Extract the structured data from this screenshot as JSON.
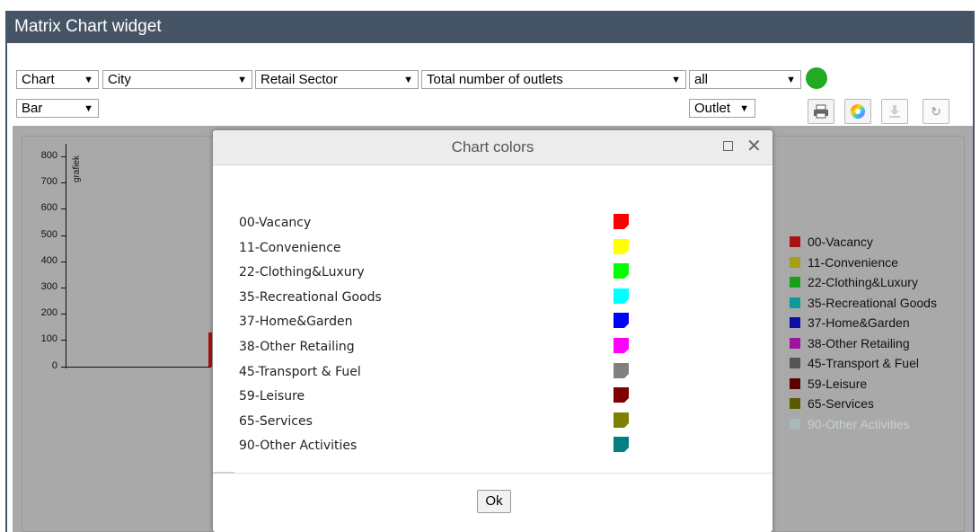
{
  "widget": {
    "title": "Matrix Chart widget"
  },
  "toolbar": {
    "chart_select": "Chart",
    "city_select": "City",
    "sector_select": "Retail Sector",
    "measure_select": "Total number of outlets",
    "filter_select": "all",
    "type_select": "Bar",
    "unit_select": "Outlet",
    "status_color": "#22aa22",
    "icons": [
      "print-icon",
      "color-wheel-icon",
      "download-icon",
      "refresh-icon"
    ]
  },
  "chart": {
    "ylabel": "grafiek",
    "yticks": [
      "800",
      "700",
      "600",
      "500",
      "400",
      "300",
      "200",
      "100",
      "0"
    ],
    "legend": [
      {
        "label": "00-Vacancy",
        "color": "#aa1111"
      },
      {
        "label": "11-Convenience",
        "color": "#a3a012"
      },
      {
        "label": "22-Clothing&Luxury",
        "color": "#18a018"
      },
      {
        "label": "35-Recreational Goods",
        "color": "#0d9a9a"
      },
      {
        "label": "37-Home&Garden",
        "color": "#0c0ca6"
      },
      {
        "label": "38-Other Retailing",
        "color": "#a012a0"
      },
      {
        "label": "45-Transport & Fuel",
        "color": "#555555"
      },
      {
        "label": "59-Leisure",
        "color": "#5a0000"
      },
      {
        "label": "65-Services",
        "color": "#5a5a00"
      },
      {
        "label": "90-Other Activities",
        "color": "#a9b8b8"
      }
    ]
  },
  "dialog": {
    "title": "Chart colors",
    "ok_label": "Ok",
    "items": [
      {
        "label": "00-Vacancy",
        "color": "#ff0000"
      },
      {
        "label": "11-Convenience",
        "color": "#ffff00"
      },
      {
        "label": "22-Clothing&Luxury",
        "color": "#00ff00"
      },
      {
        "label": "35-Recreational Goods",
        "color": "#00ffff"
      },
      {
        "label": "37-Home&Garden",
        "color": "#0000ff"
      },
      {
        "label": "38-Other Retailing",
        "color": "#ff00ff"
      },
      {
        "label": "45-Transport & Fuel",
        "color": "#808080"
      },
      {
        "label": "59-Leisure",
        "color": "#800000"
      },
      {
        "label": "65-Services",
        "color": "#808000"
      },
      {
        "label": "90-Other Activities",
        "color": "#008080"
      }
    ]
  }
}
